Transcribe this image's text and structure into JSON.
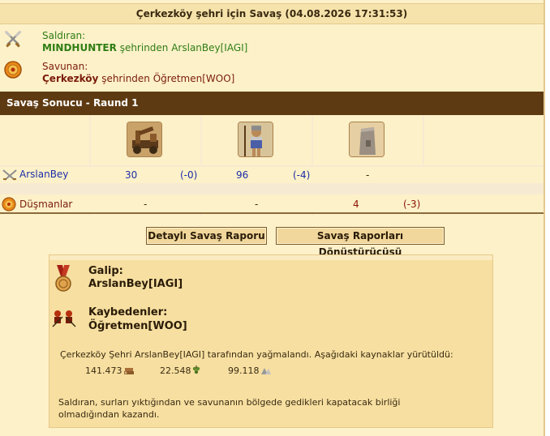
{
  "title": "Çerkezköy şehri için Savaş (04.08.2026 17:31:53)",
  "attacker": {
    "label": "Saldıran:",
    "name": "MINDHUNTER",
    "suffix": " şehrinden ArslanBey[IAGI]"
  },
  "defender": {
    "label": "Savunan:",
    "name": "Çerkezköy",
    "suffix": " şehrinden Öğretmen[WOO]"
  },
  "round_title": "Savaş Sonucu - Raund 1",
  "units": [
    "catapult",
    "spearman",
    "wall"
  ],
  "rows": [
    {
      "label": "ArslanBey",
      "cells": [
        {
          "count": "30",
          "loss": "(-0)"
        },
        {
          "count": "96",
          "loss": "(-4)"
        },
        {
          "count": "-",
          "loss": ""
        }
      ]
    },
    {
      "label": "Düşmanlar",
      "cells": [
        {
          "count": "-",
          "loss": ""
        },
        {
          "count": "-",
          "loss": ""
        },
        {
          "count": "4",
          "loss": "(-3)"
        }
      ]
    }
  ],
  "buttons": {
    "detailed_report": "Detaylı Savaş Raporu",
    "converter": "Savaş Raporları Dönüştürücüsü"
  },
  "result": {
    "winner_label": "Galip:",
    "winner": "ArslanBey[IAGI]",
    "losers_label": "Kaybedenler:",
    "losers": "Öğretmen[WOO]",
    "plunder_text": "Çerkezköy Şehri ArslanBey[IAGI] tarafından yağmalandı. Aşağıdaki kaynaklar yürütüldü:",
    "resources": [
      {
        "amount": "141.473",
        "icon": "wood-icon"
      },
      {
        "amount": "22.548",
        "icon": "wine-icon"
      },
      {
        "amount": "99.118",
        "icon": "marble-icon"
      }
    ],
    "summary": "Saldıran, surları yıktığından ve savunanın bölgede gedikleri kapatacak birliği olmadığından kazandı."
  },
  "colors": {
    "attacker_green": "#2e7d13",
    "defender_red": "#7a1c0a",
    "section_brown": "#5e3a12",
    "count_blue": "#1d2ea8"
  }
}
